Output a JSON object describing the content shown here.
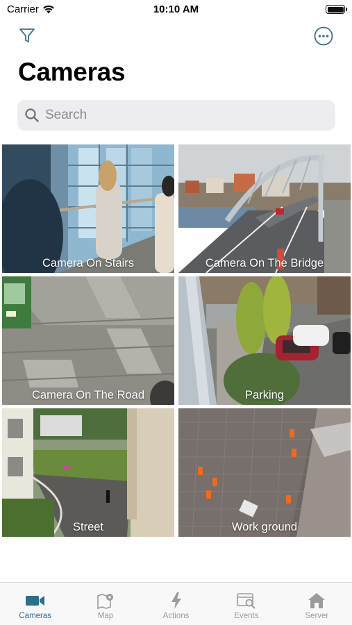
{
  "status_bar": {
    "carrier": "Carrier",
    "time": "10:10 AM"
  },
  "nav": {
    "filter_icon": "filter-icon",
    "more_icon": "more-options-icon"
  },
  "page": {
    "title": "Cameras"
  },
  "search": {
    "placeholder": "Search",
    "value": ""
  },
  "cameras": [
    {
      "name": "Camera On Stairs"
    },
    {
      "name": "Camera On The Bridge"
    },
    {
      "name": "Camera On The Road"
    },
    {
      "name": "Parking"
    },
    {
      "name": "Street"
    },
    {
      "name": "Work ground"
    }
  ],
  "tabs": [
    {
      "label": "Cameras",
      "icon": "video-camera-icon",
      "active": true
    },
    {
      "label": "Map",
      "icon": "map-pin-icon",
      "active": false
    },
    {
      "label": "Actions",
      "icon": "lightning-icon",
      "active": false
    },
    {
      "label": "Events",
      "icon": "events-search-icon",
      "active": false
    },
    {
      "label": "Server",
      "icon": "server-home-icon",
      "active": false
    }
  ],
  "colors": {
    "accent": "#2d6e8a",
    "inactive": "#9b9b9b",
    "icon_teal": "#3a6f86"
  }
}
